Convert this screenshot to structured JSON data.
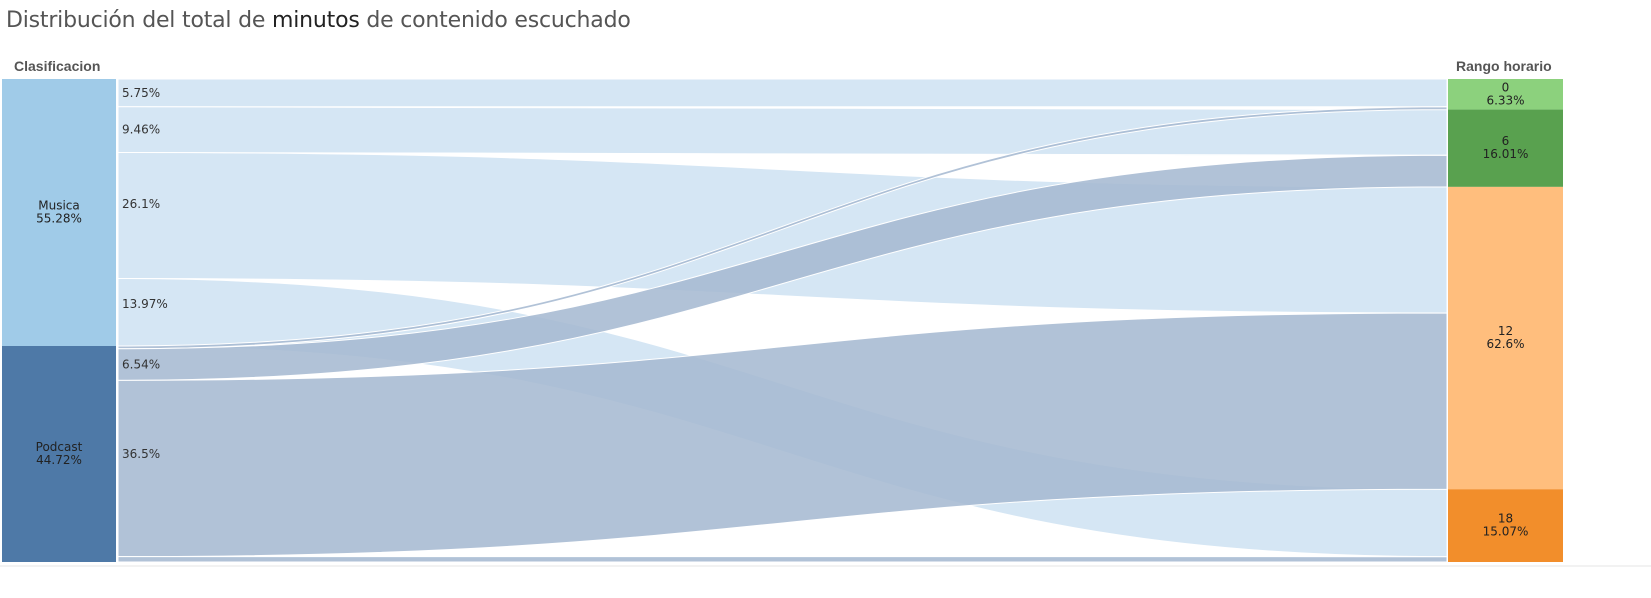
{
  "title": {
    "part1": "Distribución del total de ",
    "bold": "minutos",
    "part2": " de contenido escuchado"
  },
  "left_header": "Clasificacion",
  "right_header": "Rango horario",
  "chart_data": {
    "type": "sankey",
    "sources": [
      {
        "name": "Musica",
        "pct": "55.28%",
        "value": 55.28,
        "color": "#a0cbe8",
        "flow_color": "#cfe3f2"
      },
      {
        "name": "Podcast",
        "pct": "44.72%",
        "value": 44.72,
        "color": "#4e79a7",
        "flow_color": "#a6b9d1"
      }
    ],
    "targets": [
      {
        "name": "0",
        "pct": "6.33%",
        "value": 6.33,
        "color": "#8cd17d"
      },
      {
        "name": "6",
        "pct": "16.01%",
        "value": 16.01,
        "color": "#59a14f"
      },
      {
        "name": "12",
        "pct": "62.6%",
        "value": 62.6,
        "color": "#ffbe7d"
      },
      {
        "name": "18",
        "pct": "15.07%",
        "value": 15.07,
        "color": "#f28e2b"
      }
    ],
    "flows": [
      {
        "source": "Musica",
        "target": "0",
        "value": 5.75,
        "label": "5.75%"
      },
      {
        "source": "Musica",
        "target": "6",
        "value": 9.46,
        "label": "9.46%"
      },
      {
        "source": "Musica",
        "target": "12",
        "value": 26.1,
        "label": "26.1%"
      },
      {
        "source": "Musica",
        "target": "18",
        "value": 13.97,
        "label": "13.97%"
      },
      {
        "source": "Podcast",
        "target": "0",
        "value": 0.58,
        "label": ""
      },
      {
        "source": "Podcast",
        "target": "6",
        "value": 6.54,
        "label": "6.54%"
      },
      {
        "source": "Podcast",
        "target": "12",
        "value": 36.5,
        "label": "36.5%"
      },
      {
        "source": "Podcast",
        "target": "18",
        "value": 1.1,
        "label": ""
      }
    ]
  }
}
